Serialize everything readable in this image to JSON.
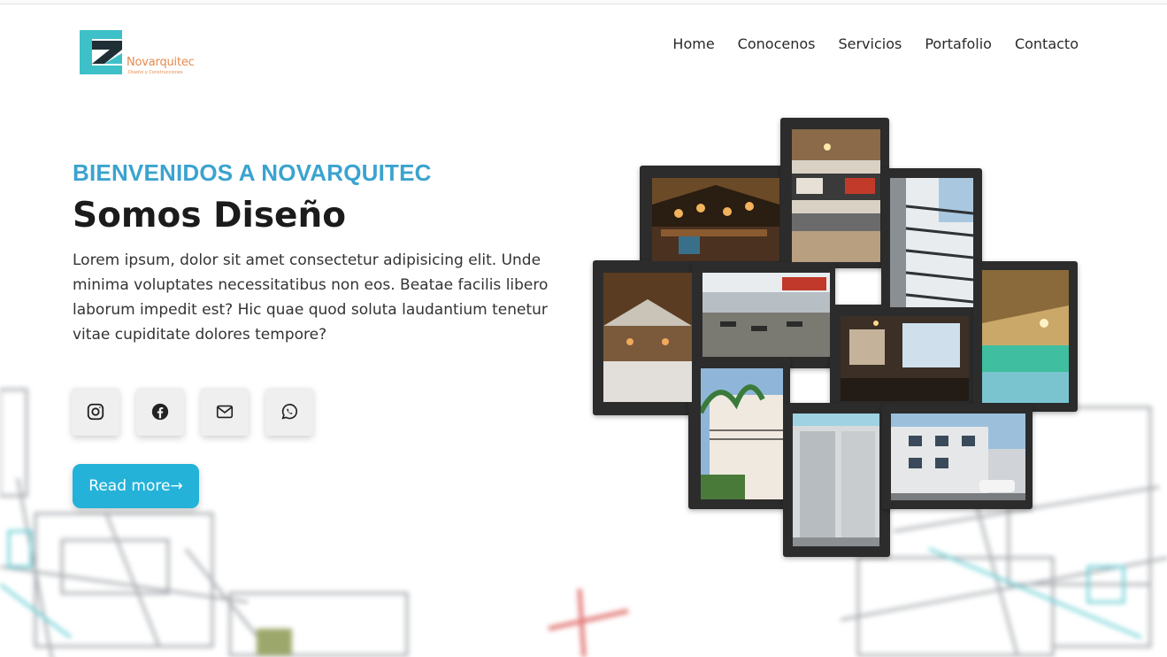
{
  "brand": {
    "name": "Novarquitec",
    "tagline": "Diseño y Construcciones",
    "colors": {
      "teal": "#3ec0c9",
      "accent": "#24b2d9",
      "orange": "#e58a4e"
    }
  },
  "nav": {
    "items": [
      "Home",
      "Conocenos",
      "Servicios",
      "Portafolio",
      "Contacto"
    ]
  },
  "hero": {
    "eyebrow": "BIENVENIDOS A NOVARQUITEC",
    "title": "Somos Diseño",
    "lead": "Lorem ipsum, dolor sit amet consectetur adipisicing elit. Unde minima voluptates necessitatibus non eos. Beatae facilis libero laborum impedit est? Hic quae quod soluta laudantium tenetur vitae cupiditate dolores tempore?",
    "cta_label": "Read more→"
  },
  "socials": [
    {
      "icon": "instagram-icon"
    },
    {
      "icon": "facebook-icon"
    },
    {
      "icon": "mail-icon"
    },
    {
      "icon": "whatsapp-icon"
    }
  ],
  "collage": {
    "photos": [
      "restaurant-interior",
      "kitchen-bar",
      "stair-atrium",
      "thatched-patio",
      "terrace-cafe",
      "dining-room",
      "resort-lounge",
      "colonial-facade",
      "bathroom",
      "building-exterior"
    ]
  }
}
